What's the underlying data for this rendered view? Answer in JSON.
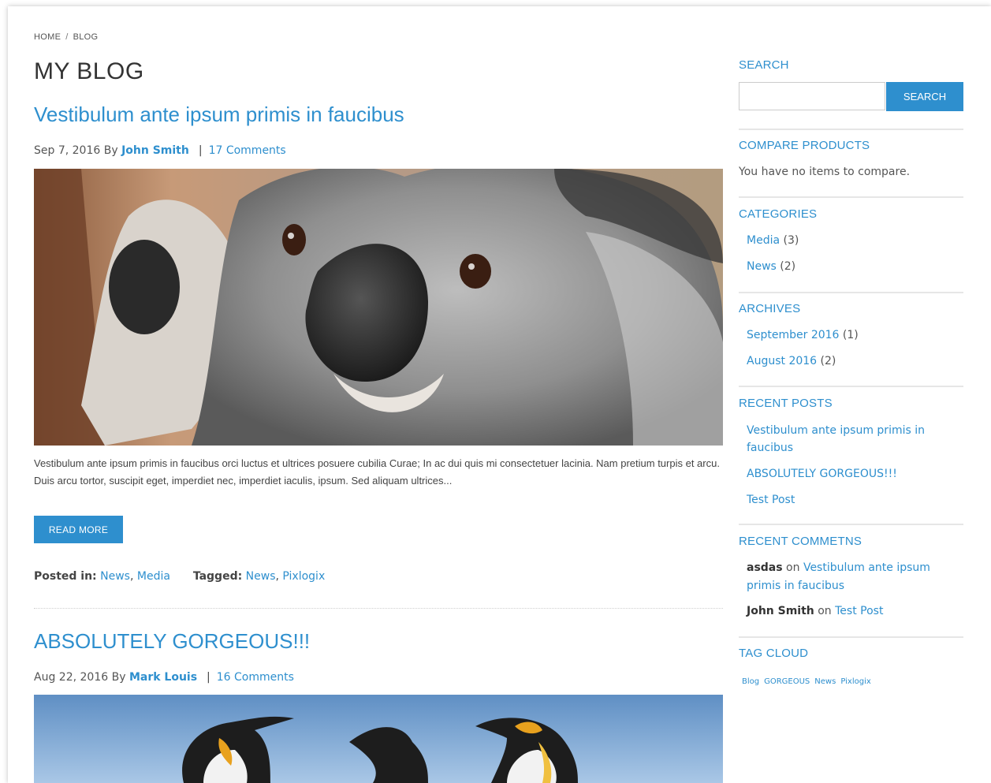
{
  "breadcrumb": {
    "home": "HOME",
    "separator": "/",
    "current": "BLOG"
  },
  "page_title": "MY BLOG",
  "posts": [
    {
      "title": "Vestibulum ante ipsum primis in faucibus",
      "date": "Sep 7, 2016",
      "by": "By",
      "author": "John Smith",
      "separator": "|",
      "comments": "17 Comments",
      "image_alt": "koala-photo",
      "excerpt": "Vestibulum ante ipsum primis in faucibus orci luctus et ultrices posuere cubilia Curae; In ac dui quis mi consectetuer lacinia. Nam pretium turpis et arcu. Duis arcu tortor, suscipit eget, imperdiet nec, imperdiet iaculis, ipsum. Sed aliquam ultrices...",
      "read_more": "READ MORE",
      "posted_in_label": "Posted in:",
      "posted_in": [
        "News",
        "Media"
      ],
      "tagged_label": "Tagged:",
      "tagged": [
        "News",
        "Pixlogix"
      ]
    },
    {
      "title": "ABSOLUTELY GORGEOUS!!!",
      "date": "Aug 22, 2016",
      "by": "By",
      "author": "Mark Louis",
      "separator": "|",
      "comments": "16 Comments",
      "image_alt": "penguins-photo"
    }
  ],
  "sidebar": {
    "search": {
      "title": "SEARCH",
      "placeholder": "",
      "button": "SEARCH"
    },
    "compare": {
      "title": "COMPARE PRODUCTS",
      "text": "You have no items to compare."
    },
    "categories": {
      "title": "CATEGORIES",
      "items": [
        {
          "label": "Media",
          "count": "(3)"
        },
        {
          "label": "News",
          "count": "(2)"
        }
      ]
    },
    "archives": {
      "title": "ARCHIVES",
      "items": [
        {
          "label": "September 2016",
          "count": "(1)"
        },
        {
          "label": "August 2016",
          "count": "(2)"
        }
      ]
    },
    "recent_posts": {
      "title": "RECENT POSTS",
      "items": [
        "Vestibulum ante ipsum primis in faucibus",
        "ABSOLUTELY GORGEOUS!!!",
        "Test Post"
      ]
    },
    "recent_comments": {
      "title": "RECENT COMMETNS",
      "items": [
        {
          "author": "asdas",
          "on": "on",
          "post": "Vestibulum ante ipsum primis in faucibus"
        },
        {
          "author": "John Smith",
          "on": "on",
          "post": "Test Post"
        }
      ]
    },
    "tag_cloud": {
      "title": "TAG CLOUD",
      "tags": [
        "Blog",
        "GORGEOUS",
        "News",
        "Pixlogix"
      ]
    }
  },
  "colors": {
    "accent": "#2e8fce",
    "text": "#333333",
    "muted": "#555555"
  }
}
